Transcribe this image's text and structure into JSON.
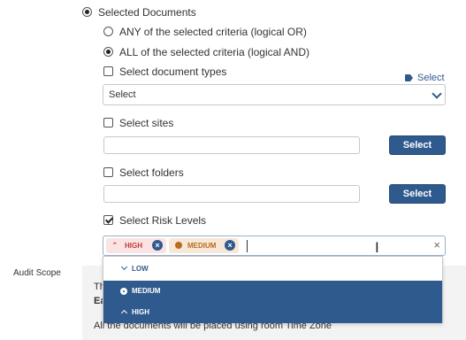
{
  "scope": {
    "selected_documents_label": "Selected Documents",
    "any_criteria_label": "ANY of the selected criteria (logical OR)",
    "all_criteria_label": "ALL of the selected criteria (logical AND)"
  },
  "doc_types": {
    "checkbox_label": "Select document types",
    "tag_select_label": "Select",
    "dropdown_value": "Select"
  },
  "sites": {
    "checkbox_label": "Select sites",
    "button_label": "Select"
  },
  "folders": {
    "checkbox_label": "Select folders",
    "button_label": "Select"
  },
  "risk": {
    "checkbox_label": "Select Risk Levels",
    "chips": [
      {
        "label": "HIGH",
        "color": "#c23b3b"
      },
      {
        "label": "MEDIUM",
        "color": "#b96b20"
      }
    ],
    "options": [
      {
        "label": "LOW",
        "selected": false
      },
      {
        "label": "MEDIUM",
        "selected": true
      },
      {
        "label": "HIGH",
        "selected": true
      }
    ]
  },
  "audit": {
    "label": "Audit Scope",
    "text_line1_fragment": "Th",
    "text_line2_fragment": "Ea",
    "text_line3": "All the documents will be placed using room Time Zone"
  },
  "colors": {
    "accent": "#2f5a8d",
    "high": "#c23b3b",
    "medium": "#b96b20"
  }
}
